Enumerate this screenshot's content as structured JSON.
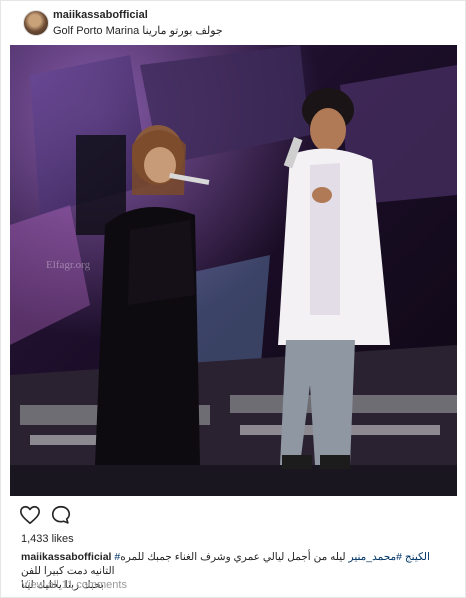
{
  "post": {
    "username": "maiikassabofficial",
    "location_arabic": "جولف بورتو مارينا",
    "location_english": "Golf Porto Marina",
    "watermark": "Elfagr.org",
    "likes": "1,433 likes",
    "caption_username": "maiikassabofficial",
    "caption_tags": "#الكينج #محمد_منير",
    "caption_text": "ليله من أجمل ليالي عمري وشرف الغناء جمبك للمره التانيه دمت كبيرا للفن",
    "caption_line2": "بحبك ربنا يخليك لينا",
    "view_comments": "View all 11 comments"
  },
  "icons": {
    "like": "heart-icon",
    "comment": "comment-bubble-icon"
  }
}
